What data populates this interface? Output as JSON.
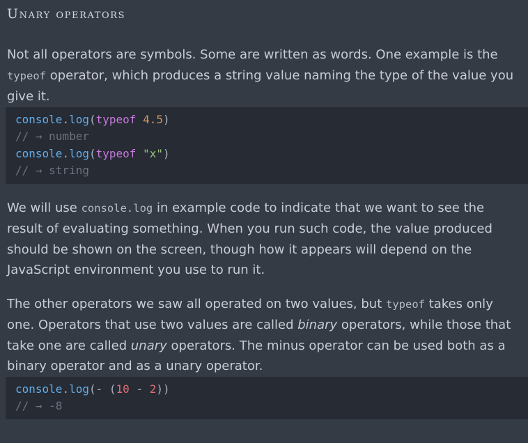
{
  "heading": "Unary operators",
  "para1": {
    "before": "Not all operators are symbols. Some are written as words. One example is the ",
    "code": "typeof",
    "after": " operator, which produces a string value naming the type of the value you give it."
  },
  "code1": {
    "line1": {
      "obj": "console",
      "dot": ".",
      "fn": "log",
      "open": "(",
      "kw": "typeof",
      "space": " ",
      "val": "4.5",
      "close": ")"
    },
    "line2": "// → number",
    "line3": {
      "obj": "console",
      "dot": ".",
      "fn": "log",
      "open": "(",
      "kw": "typeof",
      "space": " ",
      "val": "\"x\"",
      "close": ")"
    },
    "line4": "// → string"
  },
  "para2": {
    "before": "We will use ",
    "code": "console.log",
    "after": " in example code to indicate that we want to see the result of evaluating something. When you run such code, the value produced should be shown on the screen, though how it appears will depend on the JavaScript environment you use to run it."
  },
  "para3": {
    "s1": "The other operators we saw all operated on two values, but ",
    "code": "typeof",
    "s2": " takes only one. Operators that use two values are called ",
    "em1": "binary",
    "s3": " operators, while those that take one are called ",
    "em2": "unary",
    "s4": " operators. The minus operator can be used both as a binary operator and as a unary operator."
  },
  "code2": {
    "line1": {
      "obj": "console",
      "dot": ".",
      "fn": "log",
      "open": "(",
      "minus": "-",
      "space": " ",
      "paren": "(",
      "a": "10",
      "op": " - ",
      "b": "2",
      "close": "))"
    },
    "line2": "// → -8"
  }
}
